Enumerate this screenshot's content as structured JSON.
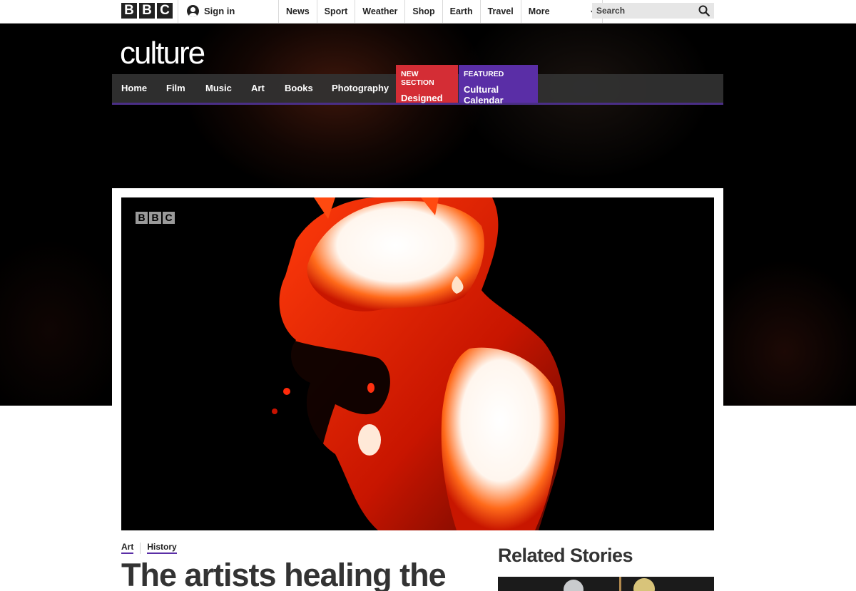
{
  "global_nav": {
    "logo_letters": [
      "B",
      "B",
      "C"
    ],
    "signin_label": "Sign in",
    "items": [
      {
        "label": "News"
      },
      {
        "label": "Sport"
      },
      {
        "label": "Weather"
      },
      {
        "label": "Shop"
      },
      {
        "label": "Earth"
      },
      {
        "label": "Travel"
      },
      {
        "label": "More"
      }
    ],
    "search_placeholder": "Search"
  },
  "section": {
    "logo_text": "culture",
    "nav_items": [
      {
        "label": "Home"
      },
      {
        "label": "Film"
      },
      {
        "label": "Music"
      },
      {
        "label": "Art"
      },
      {
        "label": "Books"
      },
      {
        "label": "Photography"
      }
    ],
    "promos": [
      {
        "kicker": "New Section",
        "title": "Designed",
        "color": "#d42d35"
      },
      {
        "kicker": "Featured",
        "title": "Cultural Calendar",
        "color": "#5a2ea6"
      }
    ],
    "nav_accent": "#4a2e86"
  },
  "video": {
    "watermark_letters": [
      "B",
      "B",
      "C"
    ]
  },
  "article": {
    "tags": [
      {
        "label": "Art"
      },
      {
        "label": "History"
      }
    ],
    "headline": "The artists healing the"
  },
  "sidebar": {
    "related_title": "Related Stories"
  }
}
